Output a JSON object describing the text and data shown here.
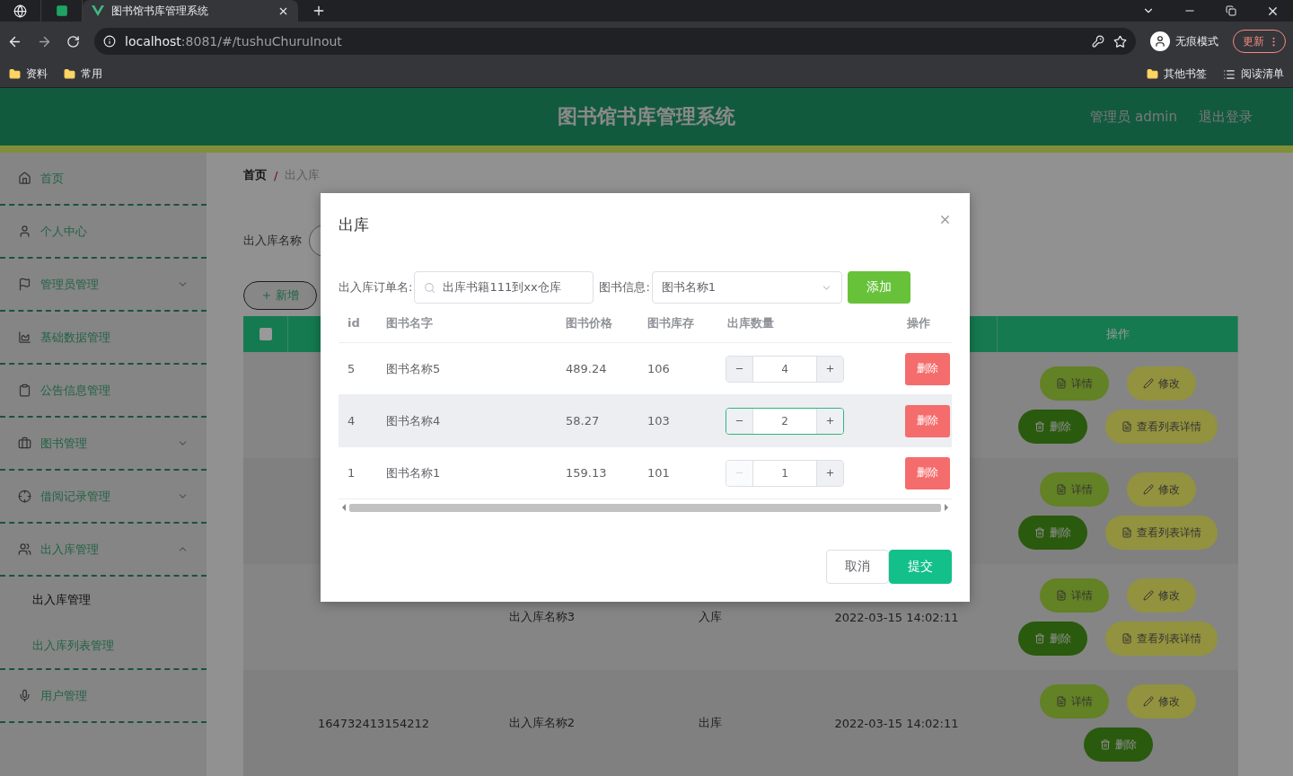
{
  "browser": {
    "tabs": [
      {
        "title": "图书馆书库管理系统",
        "selected": true
      }
    ],
    "url": {
      "host": "localhost",
      "path": ":8081/#/tushuChuruInout"
    },
    "profile": "无痕模式",
    "update": "更新",
    "bookmarks": [
      "资料",
      "常用"
    ],
    "bookmarks_right": [
      {
        "label": "其他书签",
        "kind": "folder"
      },
      {
        "label": "阅读清单",
        "kind": "list"
      }
    ]
  },
  "app": {
    "title": "图书馆书库管理系统",
    "user": "管理员 admin",
    "logout": "退出登录"
  },
  "sidebar": {
    "items": [
      {
        "label": "首页",
        "kind": "link"
      },
      {
        "label": "个人中心",
        "kind": "link"
      },
      {
        "label": "管理员管理",
        "kind": "menu",
        "expanded": false
      },
      {
        "label": "基础数据管理",
        "kind": "link"
      },
      {
        "label": "公告信息管理",
        "kind": "link"
      },
      {
        "label": "图书管理",
        "kind": "menu",
        "expanded": false
      },
      {
        "label": "借阅记录管理",
        "kind": "menu",
        "expanded": false
      },
      {
        "label": "出入库管理",
        "kind": "menu",
        "expanded": true,
        "children": [
          {
            "label": "出入库管理",
            "selected": true
          },
          {
            "label": "出入库列表管理",
            "selected": false
          }
        ]
      },
      {
        "label": "用户管理",
        "kind": "link"
      }
    ]
  },
  "breadcrumb": [
    "首页",
    "出入库"
  ],
  "breadcrumb_separator": "/",
  "search": {
    "label": "出入库名称"
  },
  "add_button": "新增",
  "table": {
    "select_all": {
      "checked": false
    },
    "action_header": "操作",
    "rows": [
      {
        "actions": [
          {
            "kind": "details",
            "label": "详情"
          },
          {
            "kind": "edit",
            "label": "修改"
          },
          {
            "kind": "delete",
            "label": "删除"
          },
          {
            "kind": "list",
            "label": "查看列表详情"
          }
        ]
      },
      {
        "actions": [
          {
            "kind": "details",
            "label": "详情"
          },
          {
            "kind": "edit",
            "label": "修改"
          },
          {
            "kind": "delete",
            "label": "删除"
          },
          {
            "kind": "list",
            "label": "查看列表详情"
          }
        ]
      },
      {
        "column_3": "出入库名称3",
        "column_4": "入库",
        "column_5": "2022-03-15 14:02:11",
        "actions": [
          {
            "kind": "details",
            "label": "详情"
          },
          {
            "kind": "edit",
            "label": "修改"
          },
          {
            "kind": "delete",
            "label": "删除"
          },
          {
            "kind": "list",
            "label": "查看列表详情"
          }
        ]
      },
      {
        "column_2": "164732413154212",
        "column_3": "出入库名称2",
        "column_4": "出库",
        "column_5": "2022-03-15 14:02:11",
        "actions": [
          {
            "kind": "details",
            "label": "详情"
          },
          {
            "kind": "edit",
            "label": "修改"
          },
          {
            "kind": "delete",
            "label": "删除"
          }
        ]
      }
    ]
  },
  "modal": {
    "title": "出库",
    "fields": [
      {
        "kind": "search",
        "label": "出入库订单名:",
        "value": "出库书籍111到xx仓库"
      },
      {
        "kind": "select",
        "label": "图书信息:",
        "value": "图书名称1"
      }
    ],
    "add_button": "添加",
    "columns": [
      "id",
      "图书名字",
      "图书价格",
      "图书库存",
      "出库数量",
      "操作"
    ],
    "rows": [
      {
        "id": "5",
        "name": "图书名称5",
        "price": "489.24",
        "stock": "106",
        "quantity": "4",
        "highlighted": false,
        "focused": false,
        "minus_disabled": false,
        "action": "删除"
      },
      {
        "id": "4",
        "name": "图书名称4",
        "price": "58.27",
        "stock": "103",
        "quantity": "2",
        "highlighted": true,
        "focused": true,
        "minus_disabled": false,
        "action": "删除"
      },
      {
        "id": "1",
        "name": "图书名称1",
        "price": "159.13",
        "stock": "101",
        "quantity": "1",
        "highlighted": false,
        "focused": false,
        "minus_disabled": true,
        "action": "删除"
      }
    ],
    "buttons": [
      {
        "kind": "secondary",
        "label": "取消"
      },
      {
        "kind": "primary",
        "label": "提交"
      }
    ]
  }
}
